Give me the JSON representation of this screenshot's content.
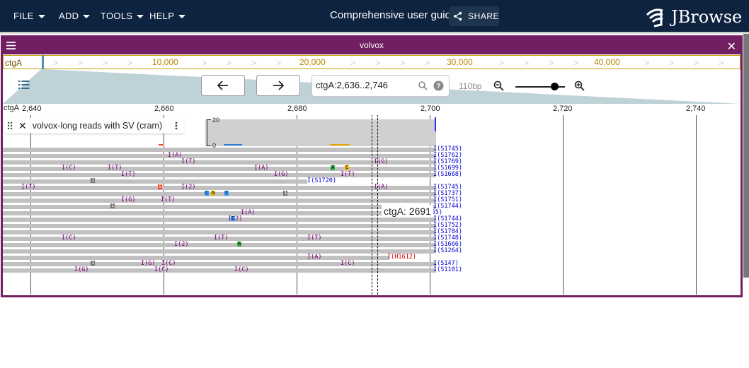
{
  "menubar": {
    "file": "FILE",
    "add": "ADD",
    "tools": "TOOLS",
    "help": "HELP",
    "session_title": "Comprehensive user guide",
    "share": "SHARE",
    "logo_text": "JBrowse"
  },
  "view": {
    "name": "volvox",
    "overview": {
      "ref": "ctgA",
      "ticks": [
        "10,000",
        "20,000",
        "30,000",
        "40,000"
      ]
    },
    "location_value": "ctgA:2,636..2,746",
    "bp_per_px": "110bp",
    "zoom_level": 0.78,
    "ruler": {
      "ref": "ctgA",
      "ticks": [
        "2,640",
        "2,660",
        "2,680",
        "2,700",
        "2,720",
        "2,740"
      ]
    },
    "track": {
      "name": "volvox-long reads with SV (cram)",
      "coverage_max": "20",
      "coverage_min": "0"
    },
    "crosshair_label": "ctgA: 2691"
  },
  "reads": {
    "labels_purple": [
      "I(A)",
      "I(T)",
      "I(C)",
      "I(T)",
      "I(T)",
      "I(A)",
      "I(G)",
      "I(T)",
      "I(G)",
      "I(T)",
      "I(2)",
      "I(A)",
      "I(G)",
      "I(T)",
      "I(A)",
      "I(2)",
      "I(C)",
      "I(T)",
      "I(T)",
      "I(2)",
      "I(A)",
      "I(C)",
      "I(G)",
      "I(C)",
      "I(G)",
      "I(C)",
      "I(C)"
    ],
    "labels_blue": [
      "I(S1745)",
      "I(S1762)",
      "I(S1769)",
      "I(S1699)",
      "I(S1668)",
      "I(S1720)",
      "I(S1745)",
      "I(S1737)",
      "I(S1751)",
      "I(S1744)",
      "I(S1755)",
      "I(S1744)",
      "I(S1752)",
      "I(S1784)",
      "I(S1748)",
      "I(S1666)",
      "I(S1264)",
      "I(S147)",
      "I(S1101)"
    ],
    "labels_red": [
      "I(H1612)"
    ],
    "gap_marker": "1",
    "bases": [
      "A",
      "C",
      "G",
      "C",
      "C",
      "G",
      "C",
      "A"
    ]
  },
  "colors": {
    "appbar": "#0d233f",
    "view_border": "#721e63",
    "insertion": "#800080",
    "soft_clip": "#0000cc",
    "hard_clip": "#cc0000"
  }
}
